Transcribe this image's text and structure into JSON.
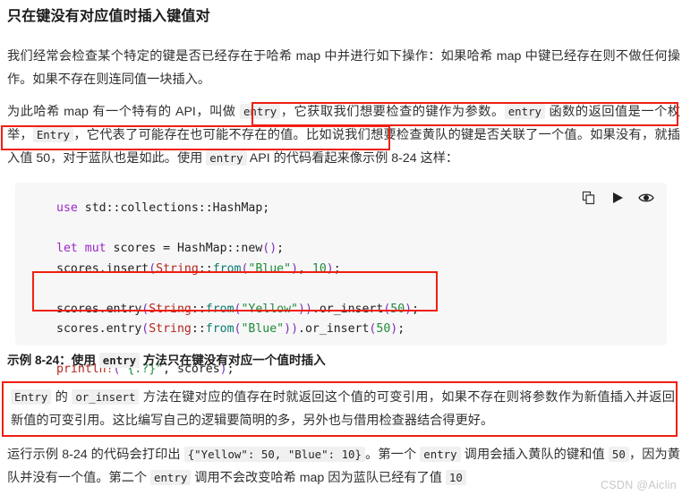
{
  "document": {
    "title": "只在键没有对应值时插入键值对",
    "watermark": "CSDN @Aiclin"
  },
  "paragraphs": {
    "intro": {
      "seg1": "我们经常会检查某个特定的键是否已经存在于哈希 map 中并进行如下操作：如果哈希 map 中键已经存在则不做任何操作。如果不存在则连同值一块插入。"
    },
    "api": {
      "seg1": "为此哈希 map 有一个特有的 API，叫做 ",
      "code1": "entry",
      "seg2": "，它获取我们想要检查的键作为参数。",
      "code2": "entry",
      "seg3": " 函数的返回值是一个枚举，",
      "code3": "Entry",
      "seg4": "，它代表了可能存在也可能不存在的值。比如说我们想要检查黄队的键是否关联了一个值。如果没有，就插入值 50，对于蓝队也是如此。使用 ",
      "code4": "entry",
      "seg5": " API 的代码看起来像示例 8-24 这样："
    },
    "caption": {
      "seg1": "示例 8-24：使用 ",
      "code1": "entry",
      "seg2": " 方法只在键没有对应一个值时插入"
    },
    "entry_note": {
      "code1": "Entry",
      "seg1": " 的 ",
      "code2": "or_insert",
      "seg2": " 方法在键对应的值存在时就返回这个值的可变引用，如果不存在则将参数作为新值插入并返回新值的可变引用。这比编写自己的逻辑要简明的多，另外也与借用检查器结合得更好。"
    },
    "result": {
      "seg1": "运行示例 8-24 的代码会打印出 ",
      "code1": "{\"Yellow\": 50, \"Blue\": 10}",
      "seg2": "。第一个 ",
      "code2": "entry",
      "seg3": " 调用会插入黄队的键和值 ",
      "code3": "50",
      "seg4": "，因为黄队并没有一个值。第二个 ",
      "code4": "entry",
      "seg5": " 调用不会改变哈希 map 因为蓝队已经有了值 ",
      "code5": "10"
    }
  },
  "code_block": {
    "language": "rust",
    "toolbar": [
      {
        "name": "copy-icon",
        "label": "复制"
      },
      {
        "name": "run-icon",
        "label": "运行"
      },
      {
        "name": "preview-icon",
        "label": "预览"
      }
    ],
    "lines": [
      {
        "id": 1,
        "text": "use std::collections::HashMap;"
      },
      {
        "id": 2,
        "text": ""
      },
      {
        "id": 3,
        "text": "let mut scores = HashMap::new();"
      },
      {
        "id": 4,
        "text": "scores.insert(String::from(\"Blue\"), 10);"
      },
      {
        "id": 5,
        "text": ""
      },
      {
        "id": 6,
        "text": "scores.entry(String::from(\"Yellow\")).or_insert(50);",
        "highlighted": true
      },
      {
        "id": 7,
        "text": "scores.entry(String::from(\"Blue\")).or_insert(50);",
        "highlighted": true
      },
      {
        "id": 8,
        "text": ""
      },
      {
        "id": 9,
        "text": "println!(\"{:?}\", scores);"
      }
    ]
  },
  "annotations": {
    "color": "#f01f12",
    "boxes": [
      {
        "name": "annotation-entry-api-line1",
        "target": "entry 函数的返回"
      },
      {
        "name": "annotation-entry-api-line2",
        "target": "值是一个枚举，Entry，它代表了可能存在也可能不存在的值。"
      },
      {
        "name": "annotation-code-entry-lines",
        "target": "scores.entry(...).or_insert(50);"
      },
      {
        "name": "annotation-entry-note",
        "target": "Entry 的 or_insert 方法说明段落"
      }
    ]
  },
  "theme": {
    "code_background": "#f7f7f8",
    "inline_code_background": "#f0f0f0",
    "text_color": "#2f2f2f",
    "annotation_red": "#f01f12",
    "watermark_color": "#c8c8c8"
  }
}
